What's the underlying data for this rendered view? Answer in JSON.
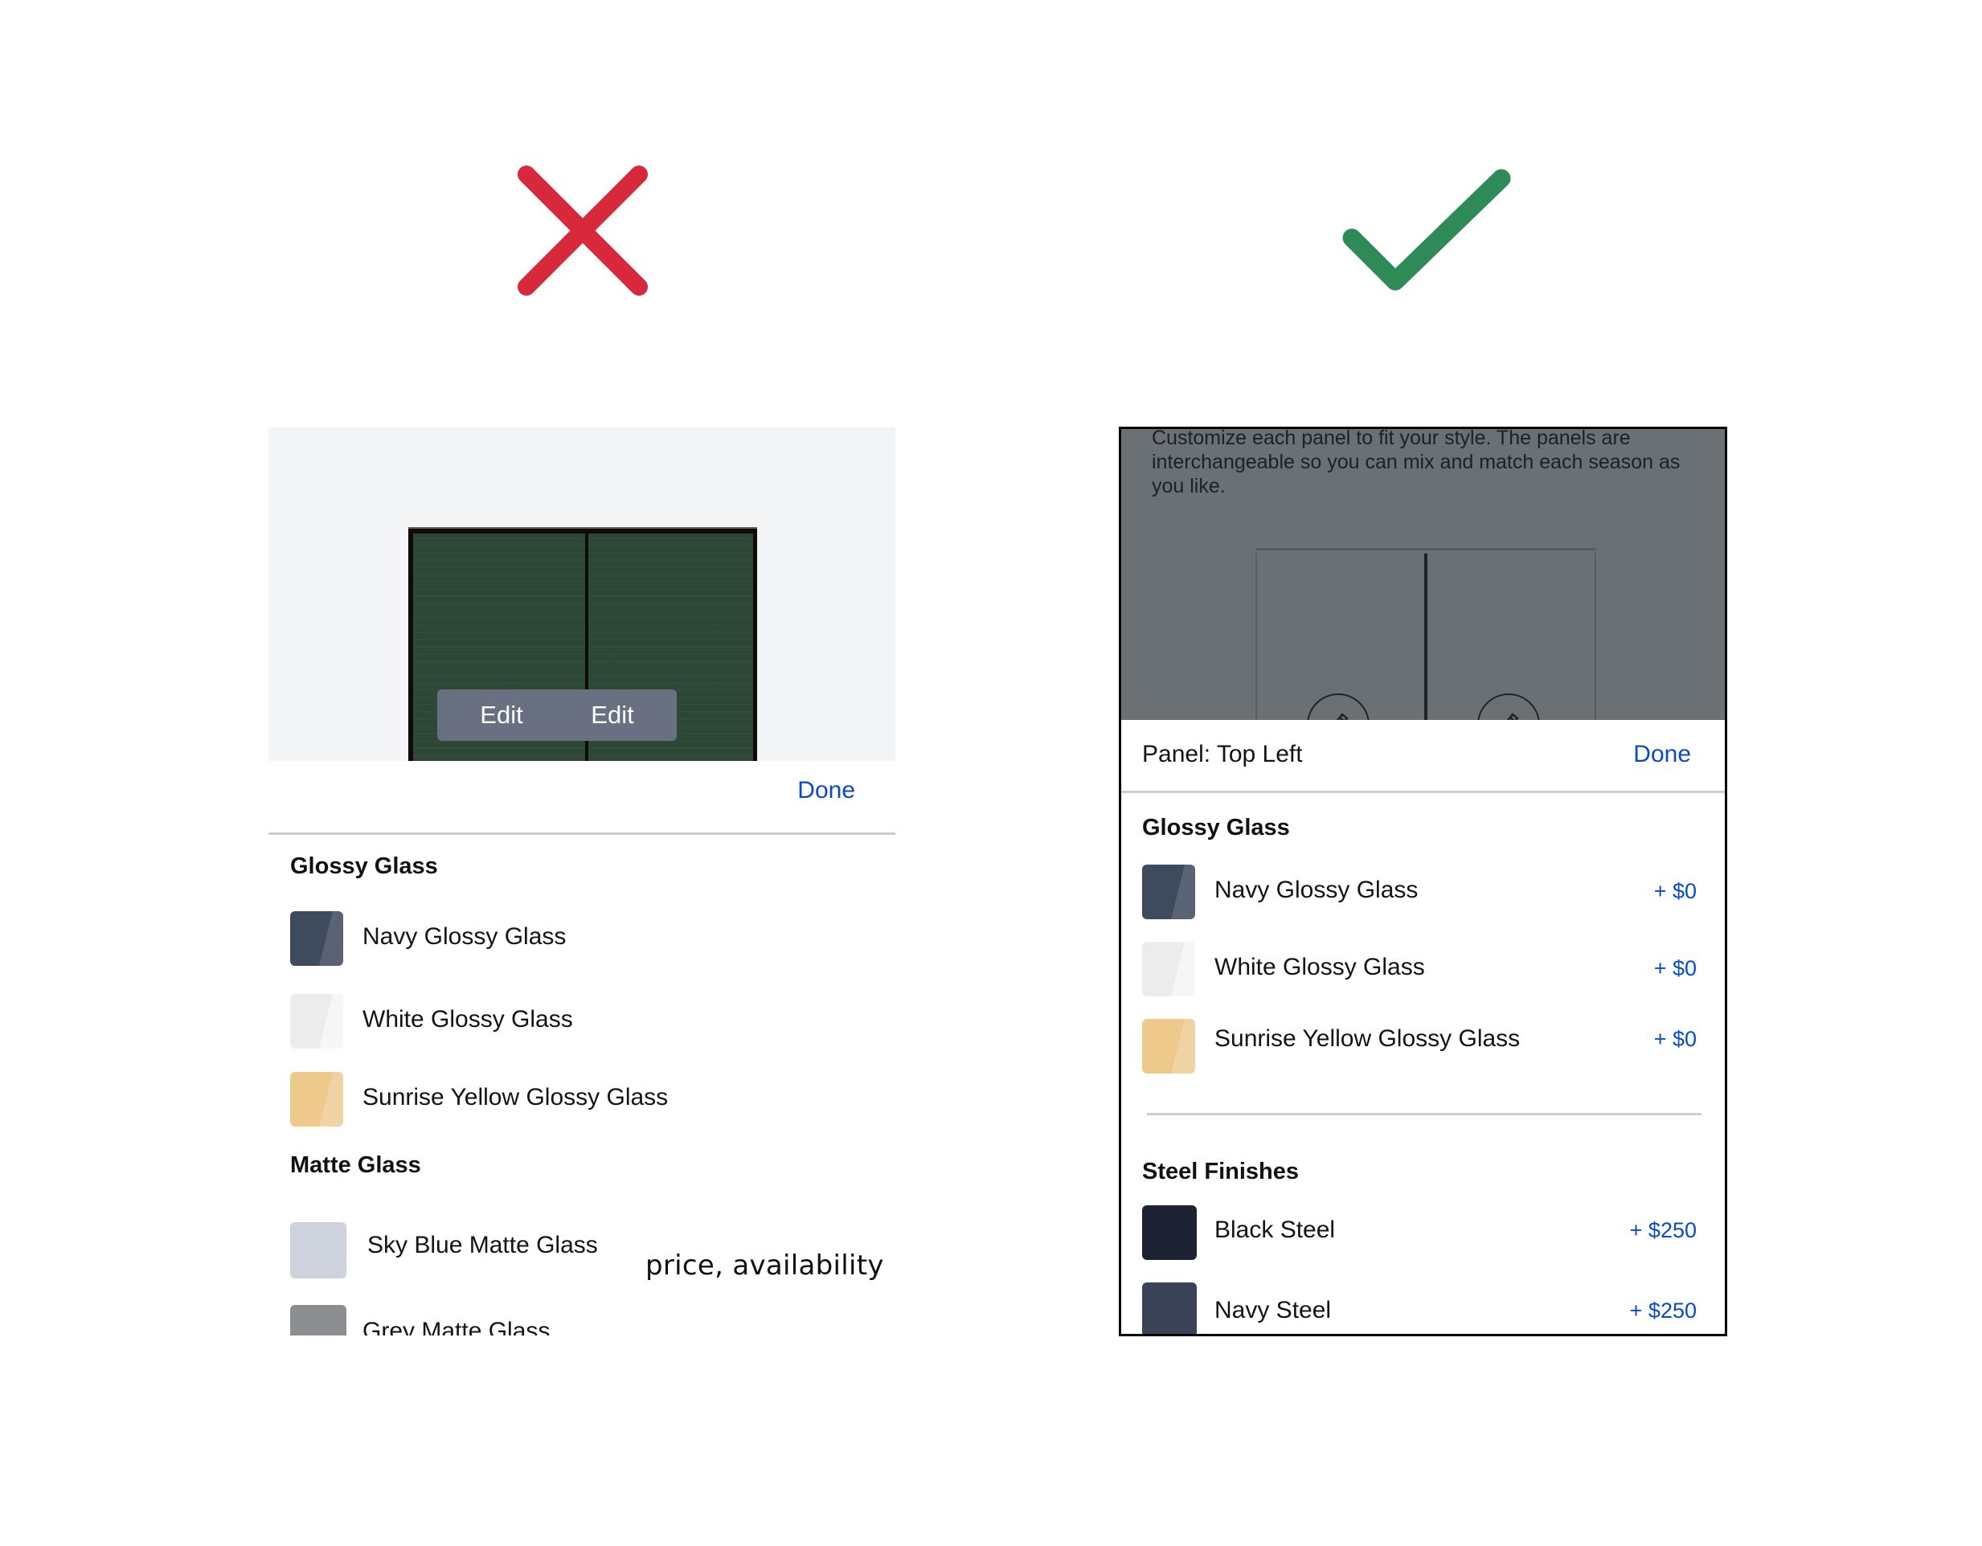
{
  "verdicts": {
    "bad": {
      "icon": "x-mark-icon",
      "color": "#d7283c"
    },
    "good": {
      "icon": "checkmark-icon",
      "color": "#2e8b57"
    }
  },
  "bad_example": {
    "preview": {
      "edit_buttons": [
        "Edit",
        "Edit"
      ],
      "panel_color": "#2f4a38"
    },
    "header": {
      "done_label": "Done"
    },
    "sections": [
      {
        "title": "Glossy Glass",
        "options": [
          {
            "label": "Navy Glossy Glass",
            "swatch": "#3e4a5e"
          },
          {
            "label": "White Glossy Glass",
            "swatch": "#ececec"
          },
          {
            "label": "Sunrise Yellow Glossy Glass",
            "swatch": "#edc98c"
          }
        ]
      },
      {
        "title": "Matte Glass",
        "options": [
          {
            "label": "Sky Blue Matte Glass",
            "swatch": "#cdd2dc"
          },
          {
            "label": "Grey Matte Glass",
            "swatch": "#8d8e92"
          }
        ]
      }
    ],
    "annotation": "price, availability"
  },
  "good_example": {
    "overlay_text": "Customize each panel to fit your style. The panels are interchangeable so you can mix and match each season as you like.",
    "header": {
      "title": "Panel: Top Left",
      "done_label": "Done"
    },
    "sections": [
      {
        "title": "Glossy Glass",
        "options": [
          {
            "label": "Navy Glossy Glass",
            "price": "+ $0",
            "swatch": "#3e4a5e"
          },
          {
            "label": "White Glossy Glass",
            "price": "+ $0",
            "swatch": "#ececec"
          },
          {
            "label": "Sunrise Yellow Glossy Glass",
            "price": "+ $0",
            "swatch": "#edc98c"
          }
        ]
      },
      {
        "title": "Steel Finishes",
        "options": [
          {
            "label": "Black Steel",
            "price": "+ $250",
            "swatch": "#1e2334"
          },
          {
            "label": "Navy Steel",
            "price": "+ $250",
            "swatch": "#3b4358"
          }
        ]
      }
    ]
  },
  "colors": {
    "accent_link": "#0a4bc4",
    "divider": "#c9ced6"
  }
}
